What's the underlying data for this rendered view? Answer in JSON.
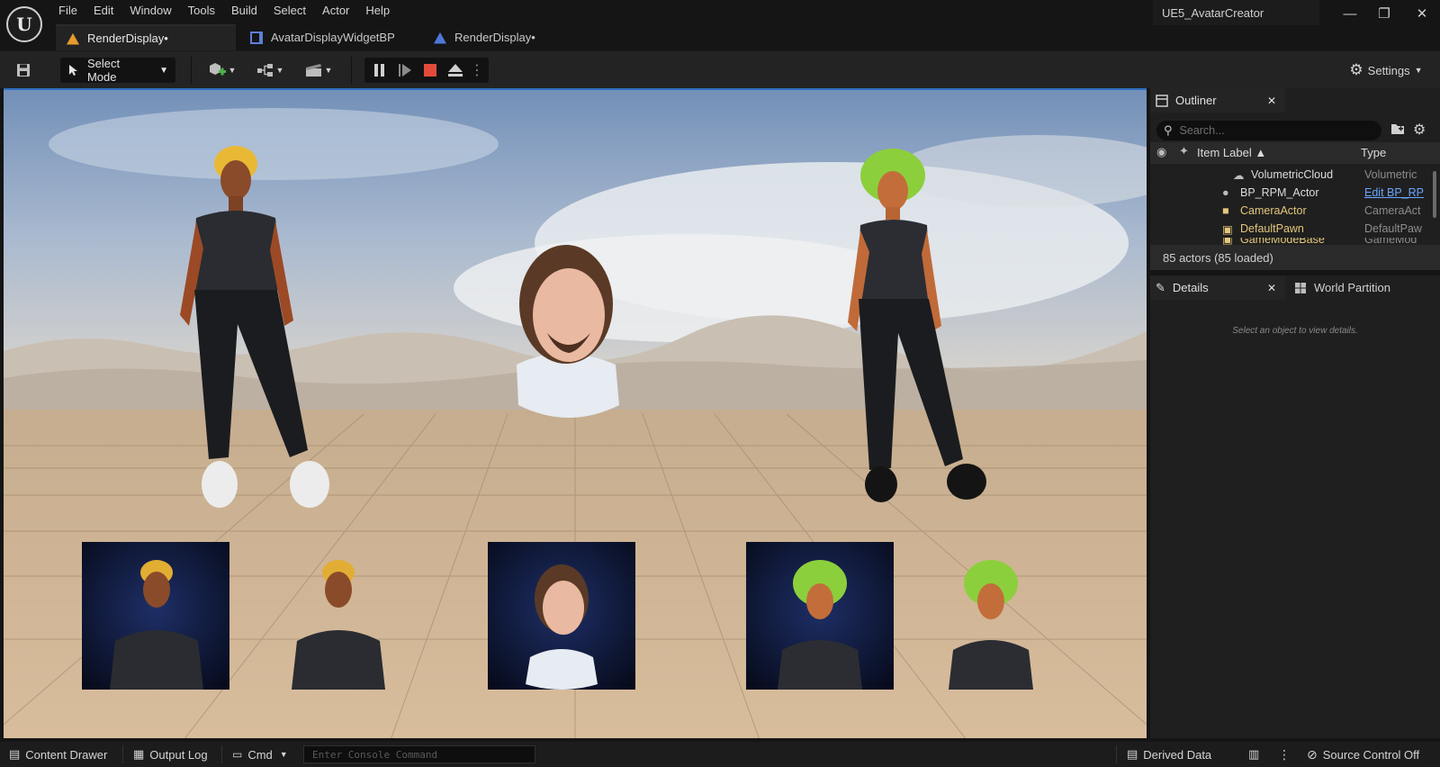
{
  "app": {
    "project_name": "UE5_AvatarCreator",
    "logo_glyph": "U"
  },
  "menu": [
    "File",
    "Edit",
    "Window",
    "Tools",
    "Build",
    "Select",
    "Actor",
    "Help"
  ],
  "tabs": [
    {
      "label": "RenderDisplay•",
      "icon": "level-icon",
      "active": true
    },
    {
      "label": "AvatarDisplayWidgetBP",
      "icon": "widget-blueprint-icon",
      "active": false
    },
    {
      "label": "RenderDisplay•",
      "icon": "level-icon",
      "active": false
    }
  ],
  "toolbar": {
    "select_mode_label": "Select Mode",
    "settings_label": "Settings"
  },
  "outliner": {
    "tab_label": "Outliner",
    "search_placeholder": "Search...",
    "col_item_label": "Item Label ▲",
    "col_type": "Type",
    "rows": [
      {
        "label": "VolumetricCloud",
        "type": "Volumetric",
        "icon": "cloud-icon"
      },
      {
        "label": "BP_RPM_Actor",
        "type": "Edit BP_RP",
        "icon": "actor-icon"
      },
      {
        "label": "CameraActor",
        "type": "CameraAct",
        "icon": "camera-icon"
      },
      {
        "label": "DefaultPawn",
        "type": "DefaultPaw",
        "icon": "pawn-icon"
      },
      {
        "label": "GameModeBase",
        "type": "GameMod",
        "icon": "gamemode-icon"
      }
    ],
    "actor_count": "85 actors (85 loaded)"
  },
  "details": {
    "tab_label": "Details",
    "world_partition_label": "World Partition",
    "empty_message": "Select an object to view details."
  },
  "statusbar": {
    "content_drawer": "Content Drawer",
    "output_log": "Output Log",
    "cmd": "Cmd",
    "console_placeholder": "Enter Console Command",
    "derived_data": "Derived Data",
    "source_control": "Source Control Off"
  },
  "colors": {
    "accent": "#2f6fc4",
    "stop_red": "#e24b3b",
    "level_orange": "#e69b2e",
    "folder_yellow": "#e3c77b",
    "link_blue": "#6aa6ff"
  }
}
